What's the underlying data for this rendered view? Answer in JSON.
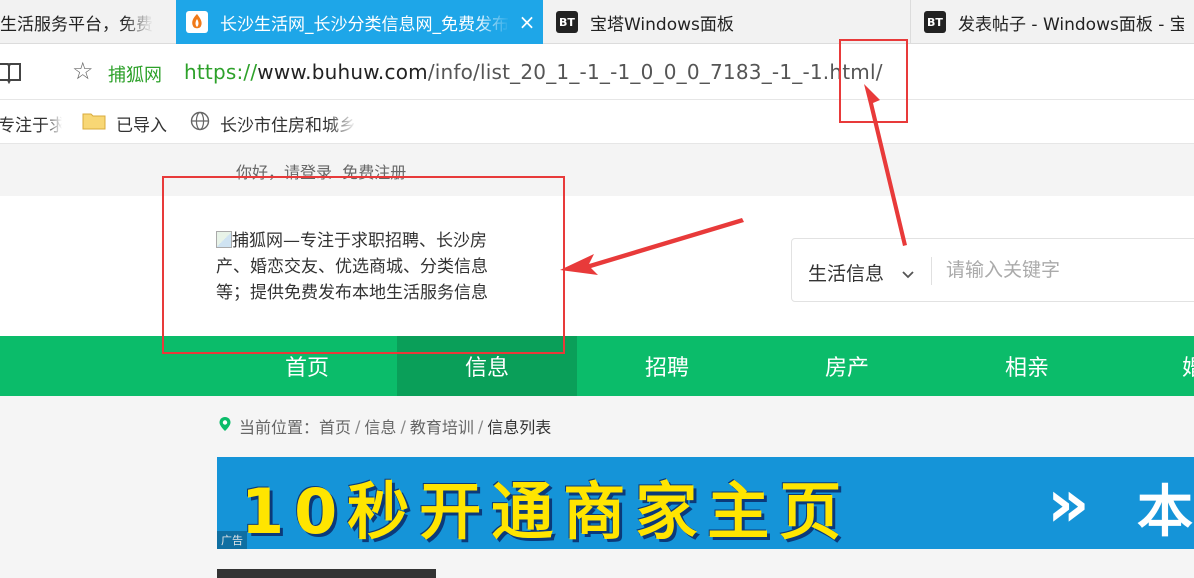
{
  "browser": {
    "tabs": [
      {
        "title": "生活服务平台，免费",
        "active": false,
        "icon": "site-icon"
      },
      {
        "title": "长沙生活网_长沙分类信息网_免费发布",
        "active": true,
        "icon": "fox-icon",
        "close": "×"
      },
      {
        "title": "宝塔Windows面板",
        "active": false,
        "icon": "bt-icon",
        "icon_text": "BT"
      },
      {
        "title": "发表帖子 - Windows面板 - 宝塔",
        "active": false,
        "icon": "bt-icon",
        "icon_text": "BT"
      }
    ],
    "address": {
      "site_name": "捕狐网",
      "url_scheme": "https://",
      "url_domain": "www.buhuw.com",
      "url_path": "/info/list_20_1_-1_-1_0_0_0_7183_-1_-1.html/"
    },
    "bookmarks": [
      {
        "label": "专注于求",
        "icon": "site-icon"
      },
      {
        "label": "已导入",
        "icon": "folder-icon"
      },
      {
        "label": "长沙市住房和城乡",
        "icon": "globe-icon"
      }
    ]
  },
  "page": {
    "greeting": {
      "hello": "你好，",
      "login": "请登录",
      "register": "免费注册"
    },
    "logo_alt": "捕狐网—专注于求职招聘、长沙房产、婚恋交友、优选商城、分类信息等；提供免费发布本地生活服务信息",
    "search": {
      "category": "生活信息",
      "placeholder": "请输入关键字"
    },
    "nav": [
      {
        "label": "首页",
        "active": false
      },
      {
        "label": "信息",
        "active": true
      },
      {
        "label": "招聘",
        "active": false
      },
      {
        "label": "房产",
        "active": false
      },
      {
        "label": "相亲",
        "active": false
      },
      {
        "label": "婚",
        "active": false
      }
    ],
    "breadcrumb": {
      "label": "当前位置：",
      "items": [
        "首页",
        "信息",
        "教育培训"
      ],
      "current": "信息列表",
      "separator": "/"
    },
    "banner": {
      "text": "10秒开通商家主页",
      "arrows": "»",
      "tail": "本",
      "ad_badge": "广告"
    }
  },
  "colors": {
    "active_tab": "#1ea6e8",
    "nav_green": "#0bbc6a",
    "nav_active": "#0a9f59",
    "annotation_red": "#e83a3a",
    "banner_blue": "#1594d8",
    "banner_yellow": "#ffe500"
  }
}
